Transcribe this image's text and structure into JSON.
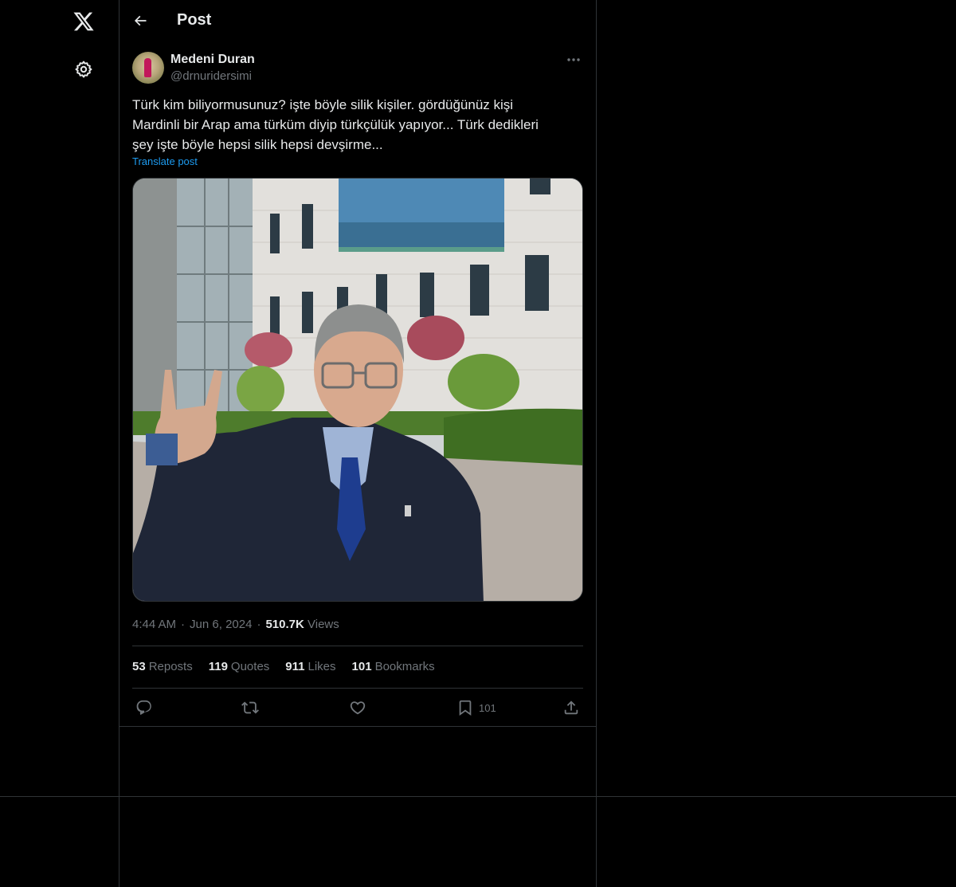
{
  "nav": {
    "logo_icon": "x-logo-icon",
    "settings_icon": "gear-icon"
  },
  "header": {
    "title": "Post",
    "back_icon": "arrow-left-icon"
  },
  "post": {
    "author_name": "Medeni Duran",
    "author_handle": "@drnuridersimi",
    "text": "Türk kim biliyormusunuz?  işte böyle silik kişiler.  gördüğünüz kişi\nMardinli bir Arap ama türküm diyip türkçülük yapıyor... Türk dedikleri\nşey işte böyle hepsi silik hepsi devşirme...",
    "translate_label": "Translate post",
    "time": "4:44 AM",
    "date": "Jun 6, 2024",
    "views_count": "510.7K",
    "views_label": "Views"
  },
  "stats": {
    "reposts_count": "53",
    "reposts_label": "Reposts",
    "quotes_count": "119",
    "quotes_label": "Quotes",
    "likes_count": "911",
    "likes_label": "Likes",
    "bookmarks_count": "101",
    "bookmarks_label": "Bookmarks"
  },
  "actions": {
    "bookmark_count": "101",
    "reply_icon": "reply-icon",
    "repost_icon": "repost-icon",
    "like_icon": "heart-icon",
    "bookmark_icon": "bookmark-icon",
    "share_icon": "share-icon"
  },
  "colors": {
    "background": "#000000",
    "text": "#e7e9ea",
    "muted": "#71767b",
    "link": "#1d9bf0",
    "border": "#2f3336"
  }
}
